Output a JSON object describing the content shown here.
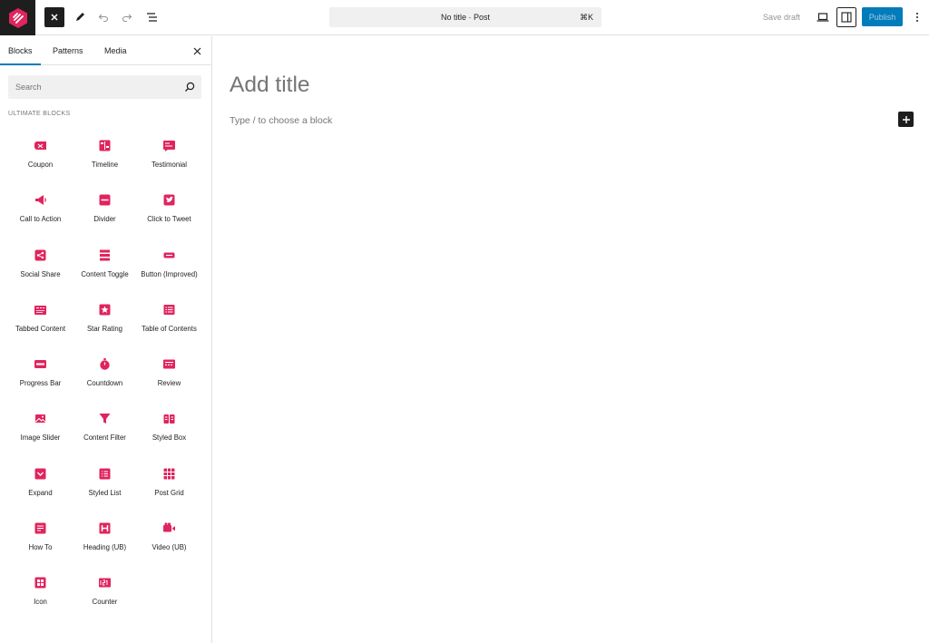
{
  "toolbar": {
    "command_palette_label": "No title · Post",
    "command_palette_shortcut": "⌘K",
    "save_draft_label": "Save draft",
    "publish_label": "Publish"
  },
  "inserter": {
    "tabs": [
      "Blocks",
      "Patterns",
      "Media"
    ],
    "active_tab": "Blocks",
    "search_placeholder": "Search",
    "category_heading": "ULTIMATE BLOCKS",
    "blocks": [
      {
        "label": "Coupon",
        "icon": "coupon-icon"
      },
      {
        "label": "Timeline",
        "icon": "timeline-icon"
      },
      {
        "label": "Testimonial",
        "icon": "testimonial-icon"
      },
      {
        "label": "Call to Action",
        "icon": "megaphone-icon"
      },
      {
        "label": "Divider",
        "icon": "divider-icon"
      },
      {
        "label": "Click to Tweet",
        "icon": "twitter-icon"
      },
      {
        "label": "Social Share",
        "icon": "share-icon"
      },
      {
        "label": "Content Toggle",
        "icon": "toggle-icon"
      },
      {
        "label": "Button (Improved)",
        "icon": "button-icon"
      },
      {
        "label": "Tabbed Content",
        "icon": "tabs-icon"
      },
      {
        "label": "Star Rating",
        "icon": "star-icon"
      },
      {
        "label": "Table of Contents",
        "icon": "toc-icon"
      },
      {
        "label": "Progress Bar",
        "icon": "progress-bar-icon"
      },
      {
        "label": "Countdown",
        "icon": "stopwatch-icon"
      },
      {
        "label": "Review",
        "icon": "review-icon"
      },
      {
        "label": "Image Slider",
        "icon": "image-slider-icon"
      },
      {
        "label": "Content Filter",
        "icon": "filter-icon"
      },
      {
        "label": "Styled Box",
        "icon": "styled-box-icon"
      },
      {
        "label": "Expand",
        "icon": "expand-icon"
      },
      {
        "label": "Styled List",
        "icon": "styled-list-icon"
      },
      {
        "label": "Post Grid",
        "icon": "post-grid-icon"
      },
      {
        "label": "How To",
        "icon": "how-to-icon"
      },
      {
        "label": "Heading (UB)",
        "icon": "heading-icon"
      },
      {
        "label": "Video (UB)",
        "icon": "video-icon"
      },
      {
        "label": "Icon",
        "icon": "icon-block-icon"
      },
      {
        "label": "Counter",
        "icon": "counter-icon"
      }
    ]
  },
  "editor": {
    "title_placeholder": "Add title",
    "appender_placeholder": "Type / to choose a block"
  },
  "colors": {
    "accent": "#007cba",
    "block_icon": "#e0245e",
    "logo": "#e0245e"
  }
}
